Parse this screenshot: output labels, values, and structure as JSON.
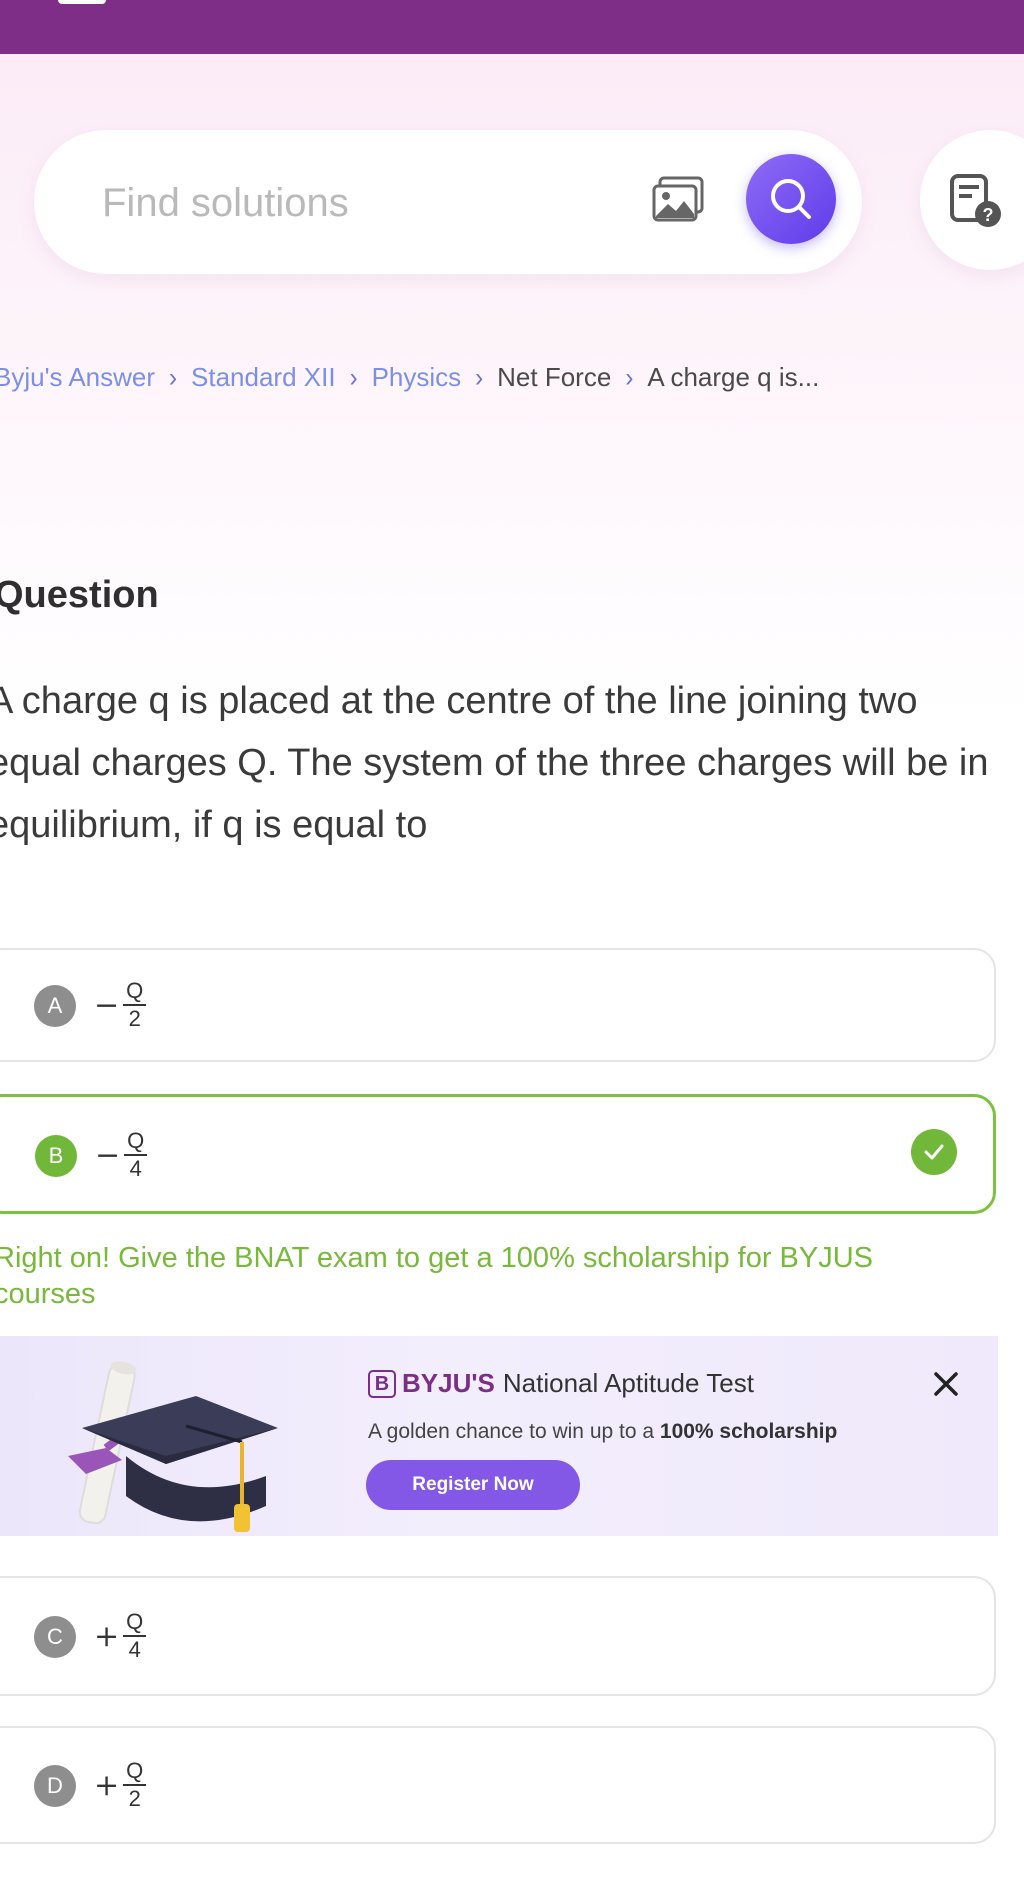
{
  "search": {
    "placeholder": "Find solutions"
  },
  "breadcrumb": [
    "Byju's Answer",
    "Standard XII",
    "Physics",
    "Net Force",
    "A charge q is..."
  ],
  "question": {
    "label": "Question",
    "text": "A charge q is placed at the centre of the line joining two equal charges Q. The system of the three charges will be in equilibrium, if q is equal to"
  },
  "options": [
    {
      "letter": "A",
      "sign": "−",
      "num": "Q",
      "den": "2",
      "correct": false
    },
    {
      "letter": "B",
      "sign": "−",
      "num": "Q",
      "den": "4",
      "correct": true
    },
    {
      "letter": "C",
      "sign": "+",
      "num": "Q",
      "den": "4",
      "correct": false
    },
    {
      "letter": "D",
      "sign": "+",
      "num": "Q",
      "den": "2",
      "correct": false
    }
  ],
  "feedback": "Right on! Give the BNAT exam to get a 100% scholarship for BYJUS courses",
  "banner": {
    "logo_letter": "B",
    "brand": "BYJU'S",
    "title": "National Aptitude Test",
    "subtitle_prefix": "A golden chance to win up to a ",
    "subtitle_bold": "100% scholarship",
    "button": "Register Now"
  },
  "colors": {
    "topbar": "#7e2e86",
    "accent": "#6b45ea",
    "correct": "#71b83a"
  },
  "icons": [
    "image-upload-icon",
    "search-icon",
    "doubt-icon",
    "chevron-right-icon",
    "check-icon",
    "close-icon",
    "graduation-cap-illustration"
  ]
}
